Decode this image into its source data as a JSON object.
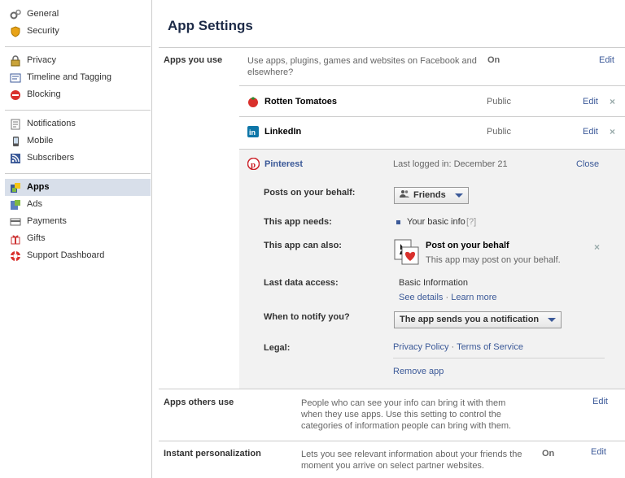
{
  "sidebar": {
    "groups": [
      [
        {
          "label": "General",
          "icon": "gears-icon"
        },
        {
          "label": "Security",
          "icon": "shield-icon"
        }
      ],
      [
        {
          "label": "Privacy",
          "icon": "lock-icon"
        },
        {
          "label": "Timeline and Tagging",
          "icon": "timeline-icon"
        },
        {
          "label": "Blocking",
          "icon": "block-icon"
        }
      ],
      [
        {
          "label": "Notifications",
          "icon": "notifications-icon"
        },
        {
          "label": "Mobile",
          "icon": "mobile-icon"
        },
        {
          "label": "Subscribers",
          "icon": "rss-icon"
        }
      ],
      [
        {
          "label": "Apps",
          "icon": "apps-icon",
          "active": true
        },
        {
          "label": "Ads",
          "icon": "ads-icon"
        },
        {
          "label": "Payments",
          "icon": "card-icon"
        },
        {
          "label": "Gifts",
          "icon": "gift-icon"
        },
        {
          "label": "Support Dashboard",
          "icon": "lifebuoy-icon"
        }
      ]
    ]
  },
  "main": {
    "title": "App Settings",
    "apps_you_use": {
      "label": "Apps you use",
      "desc": "Use apps, plugins, games and websites on Facebook and elsewhere?",
      "status": "On",
      "edit": "Edit"
    },
    "apps": [
      {
        "name": "Rotten Tomatoes",
        "visibility": "Public",
        "edit": "Edit",
        "x": "×"
      },
      {
        "name": "LinkedIn",
        "visibility": "Public",
        "edit": "Edit",
        "x": "×"
      }
    ],
    "pinterest": {
      "name": "Pinterest",
      "last_login": "Last logged in: December 21",
      "close": "Close",
      "posts_label": "Posts on your behalf:",
      "posts_value": "Friends",
      "needs_label": "This app needs:",
      "needs_value": "Your basic info",
      "needs_help": "[?]",
      "also_label": "This app can also:",
      "also_title": "Post on your behalf",
      "also_desc": "This app may post on your behalf.",
      "also_x": "×",
      "last_access_label": "Last data access:",
      "last_access_value": "Basic Information",
      "see_details": "See details",
      "sep": "·",
      "learn_more": "Learn more",
      "notify_label": "When to notify you?",
      "notify_value": "The app sends you a notification",
      "legal_label": "Legal:",
      "privacy_policy": "Privacy Policy",
      "terms": "Terms of Service",
      "remove": "Remove app"
    },
    "apps_others_use": {
      "label": "Apps others use",
      "desc": "People who can see your info can bring it with them when they use apps. Use this setting to control the categories of information people can bring with them.",
      "edit": "Edit"
    },
    "instant_personalization": {
      "label": "Instant personalization",
      "desc": "Lets you see relevant information about your friends the moment you arrive on select partner websites.",
      "status": "On",
      "edit": "Edit"
    }
  }
}
